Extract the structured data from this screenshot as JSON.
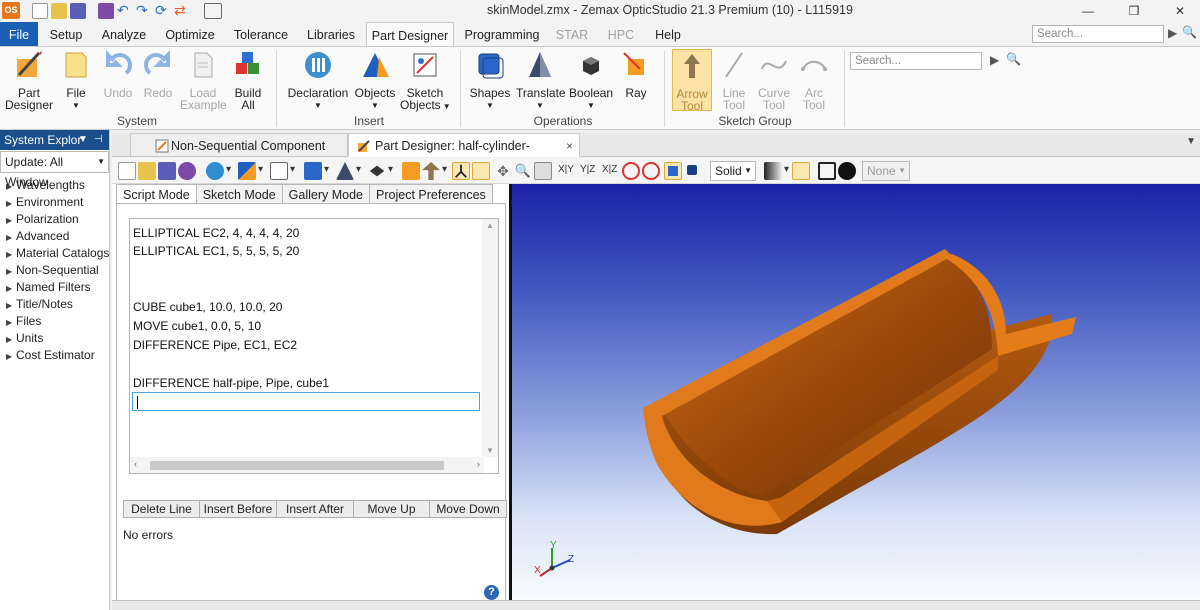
{
  "window": {
    "title": "skinModel.zmx - Zemax OpticStudio 21.3   Premium (10) - L115919",
    "app_logo": "OS"
  },
  "ribbon": {
    "tabs": [
      "File",
      "Setup",
      "Analyze",
      "Optimize",
      "Tolerance",
      "Libraries",
      "Part Designer",
      "Programming",
      "STAR",
      "HPC",
      "Help"
    ],
    "active_tab": "Part Designer",
    "search_placeholder": "Search...",
    "groups": {
      "system": {
        "label": "System",
        "buttons": [
          {
            "label": "Part",
            "label2": "Designer"
          },
          {
            "label": "File"
          },
          {
            "label": "Undo"
          },
          {
            "label": "Redo"
          },
          {
            "label": "Load",
            "label2": "Example"
          },
          {
            "label": "Build",
            "label2": "All"
          }
        ]
      },
      "insert": {
        "label": "Insert",
        "buttons": [
          {
            "label": "Declaration"
          },
          {
            "label": "Objects"
          },
          {
            "label": "Sketch",
            "label2": "Objects"
          }
        ]
      },
      "operations": {
        "label": "Operations",
        "buttons": [
          {
            "label": "Shapes"
          },
          {
            "label": "Translate"
          },
          {
            "label": "Boolean"
          },
          {
            "label": "Ray"
          }
        ]
      },
      "sketch": {
        "label": "Sketch Group",
        "buttons": [
          {
            "label": "Arrow",
            "label2": "Tool"
          },
          {
            "label": "Line",
            "label2": "Tool"
          },
          {
            "label": "Curve",
            "label2": "Tool"
          },
          {
            "label": "Arc",
            "label2": "Tool"
          }
        ]
      }
    },
    "inner_search_placeholder": "Search..."
  },
  "explorer": {
    "title": "System Explor",
    "update_label": "Update: All Window",
    "items": [
      "Wavelengths",
      "Environment",
      "Polarization",
      "Advanced",
      "Material Catalogs",
      "Non-Sequential",
      "Named Filters",
      "Title/Notes",
      "Files",
      "Units",
      "Cost Estimator"
    ]
  },
  "doc_tabs": [
    {
      "label": "Non-Sequential Component Editor"
    },
    {
      "label": "Part Designer: half-cylinder-solid.ZPO",
      "close": "×"
    }
  ],
  "part_toolbar": {
    "axis_labels": [
      "X|Y",
      "Y|Z",
      "X|Z"
    ],
    "render_mode": "Solid",
    "selection": "None"
  },
  "mode_tabs": [
    "Script Mode",
    "Sketch Mode",
    "Gallery Mode",
    "Project Preferences"
  ],
  "active_mode": "Script Mode",
  "script_lines": [
    "ELLIPTICAL EC2, 4, 4, 4, 4, 20",
    "ELLIPTICAL EC1, 5, 5, 5, 5, 20",
    "",
    "",
    "CUBE cube1, 10.0, 10.0, 20",
    "MOVE cube1, 0.0, 5, 10",
    "DIFFERENCE Pipe, EC1, EC2",
    "",
    "DIFFERENCE half-pipe, Pipe, cube1"
  ],
  "script_actions": [
    "Delete Line",
    "Insert Before",
    "Insert After",
    "Move Up",
    "Move Down"
  ],
  "status_text": "No errors",
  "axis_triad": {
    "x": "X",
    "y": "Y",
    "z": "Z"
  },
  "colors": {
    "accent": "#1a5fb4",
    "model_face": "#e07a1c",
    "model_inner": "#a44f0c",
    "explorer_header": "#1a4f8b"
  }
}
